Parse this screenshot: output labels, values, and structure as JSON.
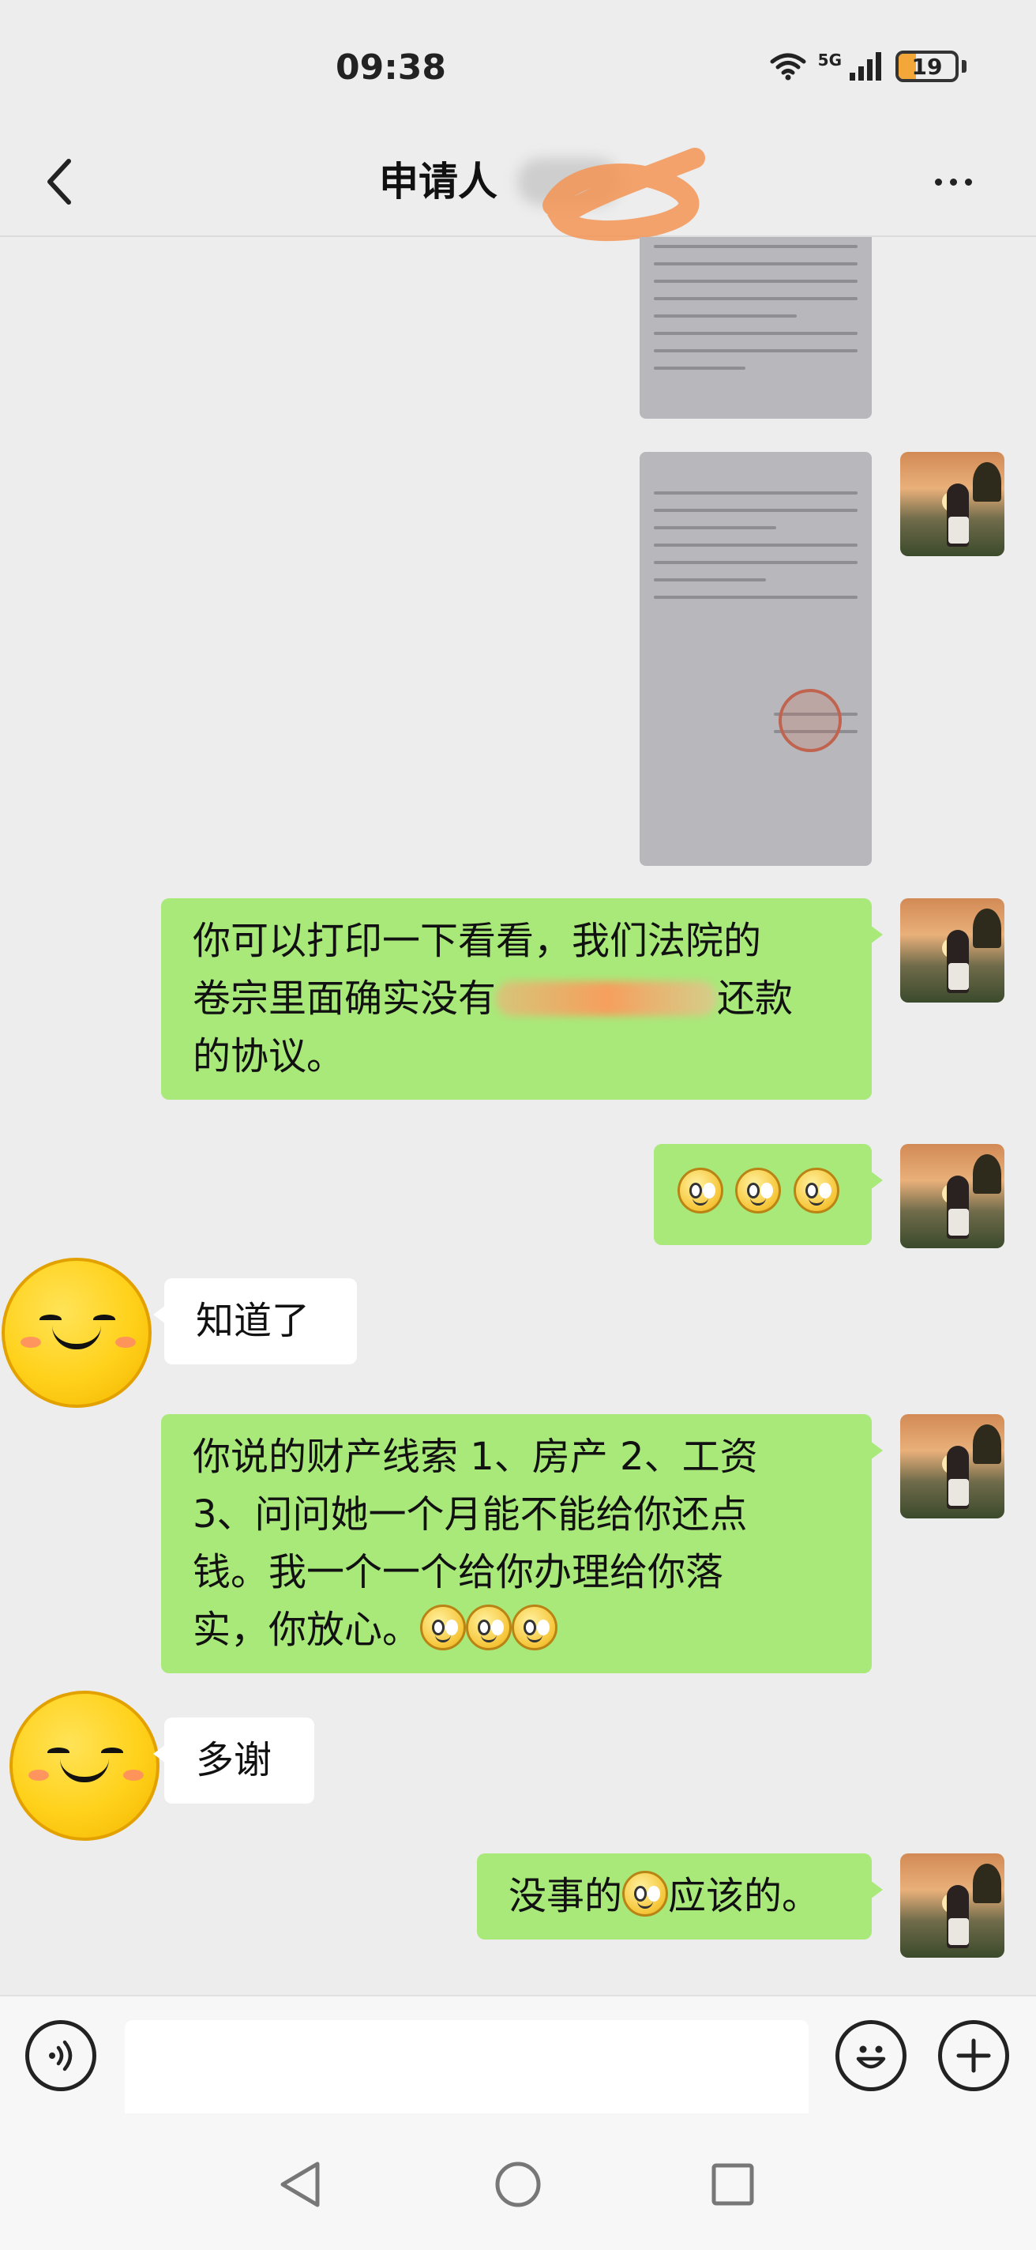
{
  "status_bar": {
    "time": "09:38",
    "network": "5G",
    "battery": "19"
  },
  "header": {
    "title": "申请人"
  },
  "messages": {
    "m1_line1": "你可以打印一下看看，我们法院的",
    "m1_line2_a": "卷宗里面确实没有",
    "m1_line2_b": "还款",
    "m1_line3": "的协议。",
    "m3": "知道了",
    "m4_line1": "你说的财产线索 1、房产 2、工资",
    "m4_line2": "3、问问她一个月能不能给你还点",
    "m4_line3": "钱。我一个一个给你办理给你落",
    "m4_line4": "实，你放心。",
    "m5": "多谢",
    "m6_a": "没事的",
    "m6_b": "应该的。"
  },
  "input": {
    "value": ""
  },
  "icons": {
    "back": "chevron-left-icon",
    "more": "more-dots-icon",
    "voice": "voice-icon",
    "emoji": "emoji-icon",
    "plus": "plus-icon",
    "accent_bubble": "#a9e97a",
    "background": "#ededed"
  }
}
